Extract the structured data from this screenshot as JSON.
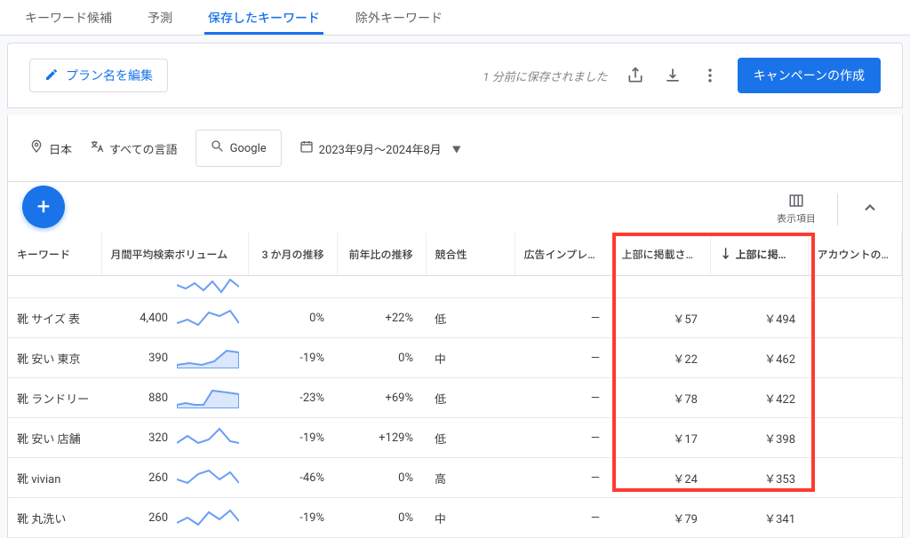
{
  "tabs": [
    {
      "label": "キーワード候補",
      "active": false
    },
    {
      "label": "予測",
      "active": false
    },
    {
      "label": "保存したキーワード",
      "active": true
    },
    {
      "label": "除外キーワード",
      "active": false
    }
  ],
  "toolbar": {
    "edit_plan_label": "プラン名を編集",
    "saved_text": "1 分前に保存されました",
    "create_campaign_label": "キャンペーンの作成"
  },
  "filters": {
    "location": "日本",
    "language": "すべての言語",
    "network": "Google",
    "date_range": "2023年9月～2024年8月"
  },
  "table_bar": {
    "columns_label": "表示項目"
  },
  "columns": {
    "keyword": "キーワード",
    "volume": "月間平均検索ボリューム",
    "three_month": "3 か月の推移",
    "yoy": "前年比の推移",
    "competition": "競合性",
    "impressions": "広告インプレッション",
    "top_low": "上部に掲載された",
    "top_high": "上部に掲載さ",
    "account": "アカウントのステータス"
  },
  "rows": [
    {
      "keyword": "靴 サイズ 表",
      "volume": "4,400",
      "three_month": "0%",
      "yoy": "+22%",
      "competition": "低",
      "impressions": "—",
      "top_low": "￥57",
      "top_high": "￥494"
    },
    {
      "keyword": "靴 安い 東京",
      "volume": "390",
      "three_month": "-19%",
      "yoy": "0%",
      "competition": "中",
      "impressions": "—",
      "top_low": "￥22",
      "top_high": "￥462"
    },
    {
      "keyword": "靴 ランドリー",
      "volume": "880",
      "three_month": "-23%",
      "yoy": "+69%",
      "competition": "低",
      "impressions": "—",
      "top_low": "￥78",
      "top_high": "￥422"
    },
    {
      "keyword": "靴 安い 店舗",
      "volume": "320",
      "three_month": "-19%",
      "yoy": "+129%",
      "competition": "低",
      "impressions": "—",
      "top_low": "￥17",
      "top_high": "￥398"
    },
    {
      "keyword": "靴 vivian",
      "volume": "260",
      "three_month": "-46%",
      "yoy": "0%",
      "competition": "高",
      "impressions": "—",
      "top_low": "￥24",
      "top_high": "￥353"
    },
    {
      "keyword": "靴 丸洗い",
      "volume": "260",
      "three_month": "-19%",
      "yoy": "0%",
      "competition": "中",
      "impressions": "—",
      "top_low": "￥79",
      "top_high": "￥341"
    }
  ],
  "sparklines": [
    "M0,10 L10,14 L20,8 L30,16 L40,6 L50,18 L60,4 L70,12",
    "M0,18 L12,14 L24,20 L36,6 L48,10 L60,4 L70,18",
    "M0,20 L14,18 L28,20 L42,16 L56,4 L70,6 L70,24 L0,24 Z",
    "M0,20 L10,18 L20,20 L30,20 L40,4 L56,6 L70,8 L70,24 L0,24 Z",
    "M0,18 L12,10 L24,18 L36,14 L48,2 L60,16 L70,18",
    "M0,14 L12,18 L24,8 L36,4 L48,14 L60,6 L70,18",
    "M0,18 L12,12 L24,20 L36,6 L48,14 L60,4 L70,16"
  ]
}
